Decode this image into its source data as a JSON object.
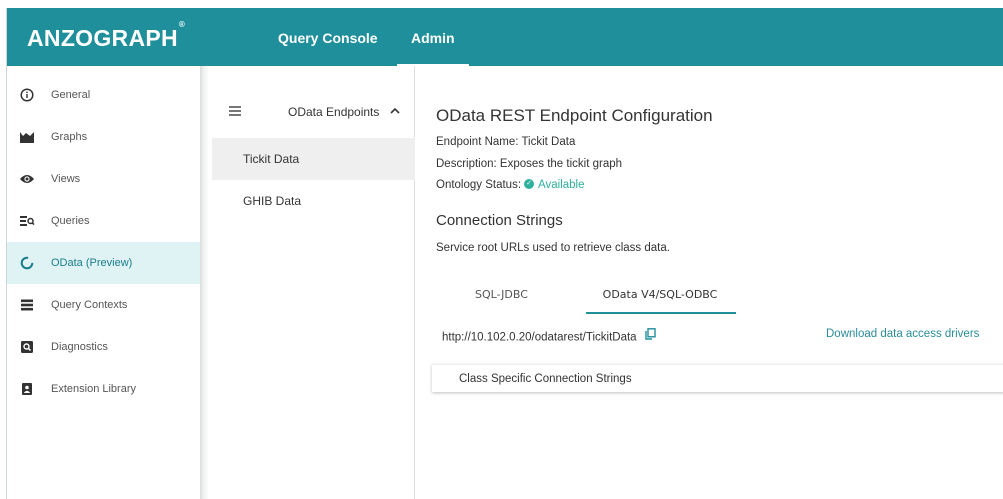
{
  "header": {
    "logo": "ANZOGRAPH",
    "logo_mark": "®",
    "nav": [
      {
        "label": "Query Console"
      },
      {
        "label": "Admin"
      }
    ],
    "bg_color": "#1f8f9c"
  },
  "sidebar": {
    "items": [
      {
        "label": "General",
        "icon": "info-icon"
      },
      {
        "label": "Graphs",
        "icon": "graph-icon"
      },
      {
        "label": "Views",
        "icon": "eye-icon"
      },
      {
        "label": "Queries",
        "icon": "queries-icon"
      },
      {
        "label": "OData (Preview)",
        "icon": "odata-icon",
        "active": true
      },
      {
        "label": "Query Contexts",
        "icon": "list-icon"
      },
      {
        "label": "Diagnostics",
        "icon": "diagnostics-icon"
      },
      {
        "label": "Extension Library",
        "icon": "library-icon"
      }
    ],
    "active_color": "#dff3f5"
  },
  "midpanel": {
    "title": "OData Endpoints",
    "items": [
      {
        "label": "Tickit Data",
        "active": true
      },
      {
        "label": "GHIB Data"
      }
    ]
  },
  "content": {
    "title": "OData REST Endpoint Configuration",
    "endpoint_name": "Endpoint Name: Tickit Data",
    "description": "Description: Exposes the tickit graph",
    "ontology_status_label": "Ontology Status:",
    "ontology_status_value": "Available",
    "connection_title": "Connection Strings",
    "connection_desc": "Service root URLs used to retrieve class data.",
    "tabs": [
      {
        "label": "SQL-JDBC"
      },
      {
        "label": "OData V4/SQL-ODBC",
        "active": true
      }
    ],
    "url": "http://10.102.0.20/odatarest/TickitData",
    "download_link": "Download data access drivers",
    "class_panel_label": "Class Specific Connection Strings",
    "accent_color": "#1f8f9c",
    "status_color": "#2fb09c"
  }
}
